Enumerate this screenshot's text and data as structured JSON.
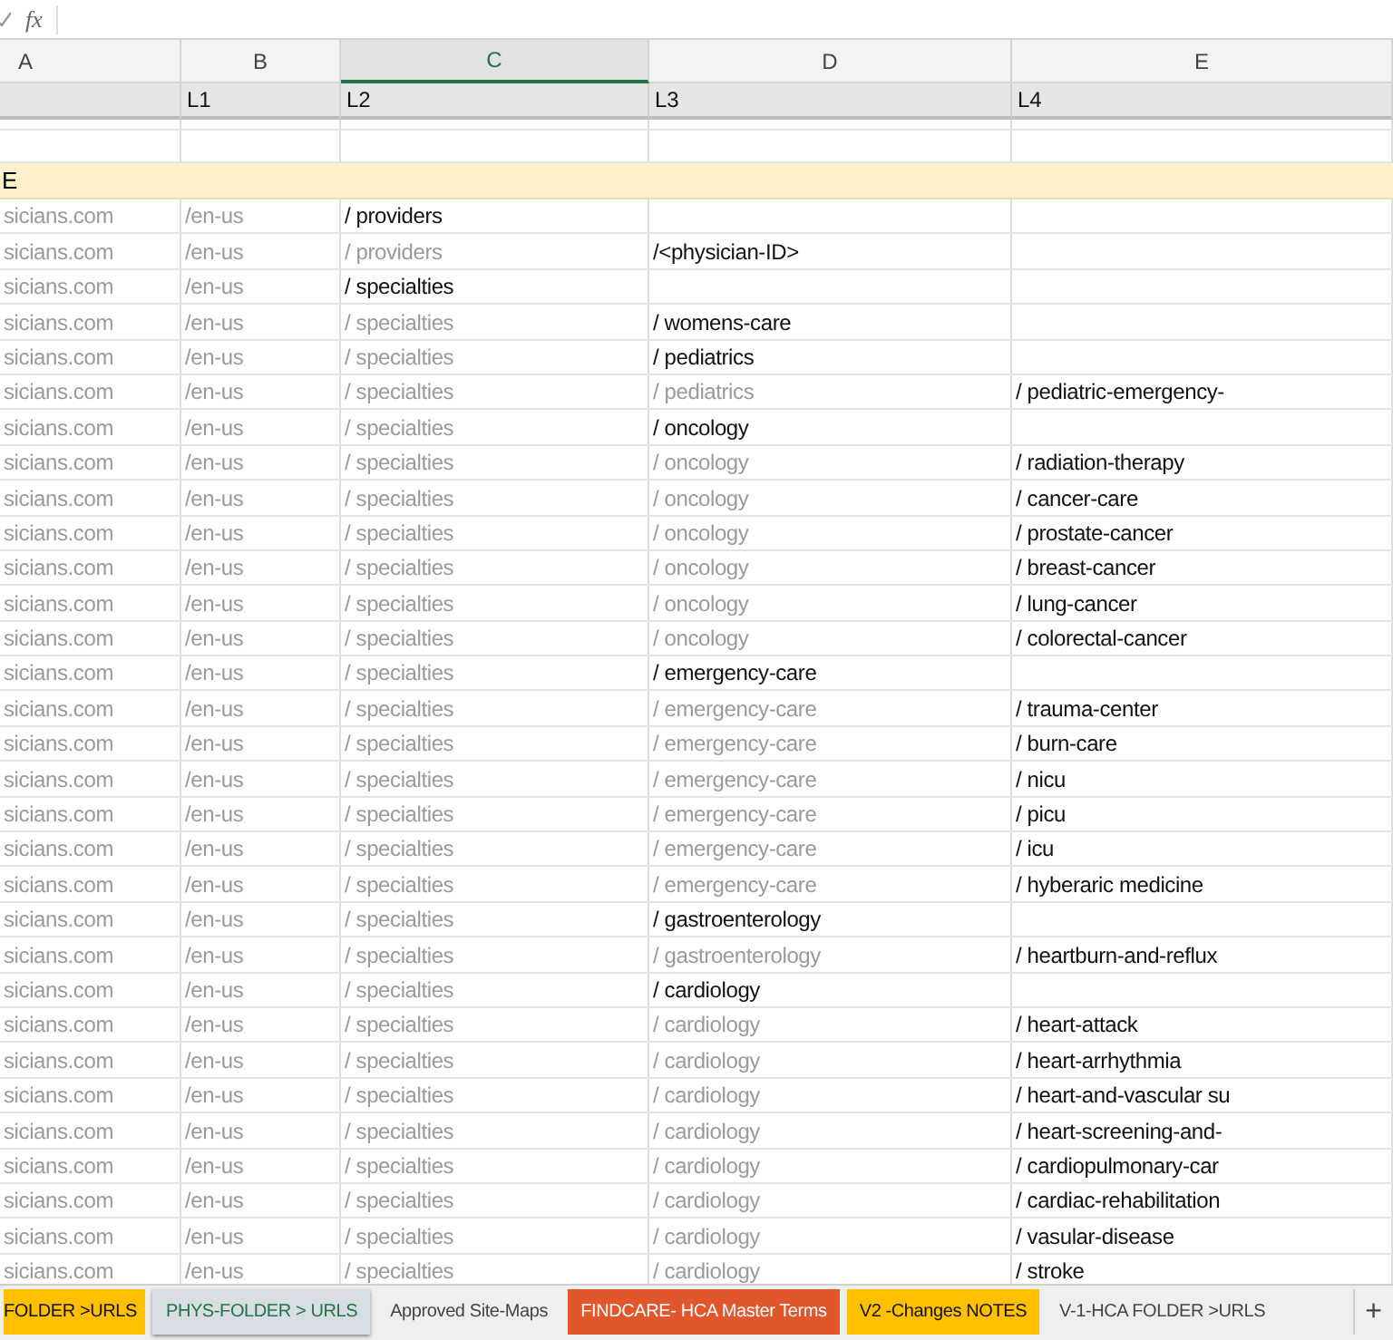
{
  "formula_bar": {
    "function_label": "fx"
  },
  "column_headers": [
    {
      "label": "A",
      "selected": false
    },
    {
      "label": "B",
      "selected": false
    },
    {
      "label": "C",
      "selected": true
    },
    {
      "label": "D",
      "selected": false
    },
    {
      "label": "E",
      "selected": false
    }
  ],
  "level_header": {
    "b": "L1",
    "c": "L2",
    "d": "L3",
    "e": "L4"
  },
  "section_row": {
    "label": "E"
  },
  "rows": [
    {
      "a": {
        "text": "sicians.com",
        "dim": true
      },
      "b": {
        "text": "/en-us",
        "dim": true
      },
      "c": {
        "text": "/ providers",
        "dim": false
      }
    },
    {
      "a": {
        "text": "sicians.com",
        "dim": true
      },
      "b": {
        "text": "/en-us",
        "dim": true
      },
      "c": {
        "text": "/ providers",
        "dim": true
      },
      "d": {
        "text": "/<physician-ID>",
        "dim": false
      }
    },
    {
      "a": {
        "text": "sicians.com",
        "dim": true
      },
      "b": {
        "text": "/en-us",
        "dim": true
      },
      "c": {
        "text": "/ specialties",
        "dim": false
      }
    },
    {
      "a": {
        "text": "sicians.com",
        "dim": true
      },
      "b": {
        "text": "/en-us",
        "dim": true
      },
      "c": {
        "text": "/ specialties",
        "dim": true
      },
      "d": {
        "text": "/ womens-care",
        "dim": false
      }
    },
    {
      "a": {
        "text": "sicians.com",
        "dim": true
      },
      "b": {
        "text": "/en-us",
        "dim": true
      },
      "c": {
        "text": "/ specialties",
        "dim": true
      },
      "d": {
        "text": "/ pediatrics",
        "dim": false
      }
    },
    {
      "a": {
        "text": "sicians.com",
        "dim": true
      },
      "b": {
        "text": "/en-us",
        "dim": true
      },
      "c": {
        "text": "/ specialties",
        "dim": true
      },
      "d": {
        "text": "/ pediatrics",
        "dim": true
      },
      "e": {
        "text": "/ pediatric-emergency-",
        "dim": false
      }
    },
    {
      "a": {
        "text": "sicians.com",
        "dim": true
      },
      "b": {
        "text": "/en-us",
        "dim": true
      },
      "c": {
        "text": "/ specialties",
        "dim": true
      },
      "d": {
        "text": "/ oncology",
        "dim": false
      }
    },
    {
      "a": {
        "text": "sicians.com",
        "dim": true
      },
      "b": {
        "text": "/en-us",
        "dim": true
      },
      "c": {
        "text": "/ specialties",
        "dim": true
      },
      "d": {
        "text": "/ oncology",
        "dim": true
      },
      "e": {
        "text": "/ radiation-therapy",
        "dim": false
      }
    },
    {
      "a": {
        "text": "sicians.com",
        "dim": true
      },
      "b": {
        "text": "/en-us",
        "dim": true
      },
      "c": {
        "text": "/ specialties",
        "dim": true
      },
      "d": {
        "text": "/ oncology",
        "dim": true
      },
      "e": {
        "text": "/ cancer-care",
        "dim": false
      }
    },
    {
      "a": {
        "text": "sicians.com",
        "dim": true
      },
      "b": {
        "text": "/en-us",
        "dim": true
      },
      "c": {
        "text": "/ specialties",
        "dim": true
      },
      "d": {
        "text": "/ oncology",
        "dim": true
      },
      "e": {
        "text": "/ prostate-cancer",
        "dim": false
      }
    },
    {
      "a": {
        "text": "sicians.com",
        "dim": true
      },
      "b": {
        "text": "/en-us",
        "dim": true
      },
      "c": {
        "text": "/ specialties",
        "dim": true
      },
      "d": {
        "text": "/ oncology",
        "dim": true
      },
      "e": {
        "text": "/ breast-cancer",
        "dim": false
      }
    },
    {
      "a": {
        "text": "sicians.com",
        "dim": true
      },
      "b": {
        "text": "/en-us",
        "dim": true
      },
      "c": {
        "text": "/ specialties",
        "dim": true
      },
      "d": {
        "text": "/ oncology",
        "dim": true
      },
      "e": {
        "text": "/ lung-cancer",
        "dim": false
      }
    },
    {
      "a": {
        "text": "sicians.com",
        "dim": true
      },
      "b": {
        "text": "/en-us",
        "dim": true
      },
      "c": {
        "text": "/ specialties",
        "dim": true
      },
      "d": {
        "text": "/ oncology",
        "dim": true
      },
      "e": {
        "text": "/ colorectal-cancer",
        "dim": false
      }
    },
    {
      "a": {
        "text": "sicians.com",
        "dim": true
      },
      "b": {
        "text": "/en-us",
        "dim": true
      },
      "c": {
        "text": "/ specialties",
        "dim": true
      },
      "d": {
        "text": "/ emergency-care",
        "dim": false
      }
    },
    {
      "a": {
        "text": "sicians.com",
        "dim": true
      },
      "b": {
        "text": "/en-us",
        "dim": true
      },
      "c": {
        "text": "/ specialties",
        "dim": true
      },
      "d": {
        "text": "/ emergency-care",
        "dim": true
      },
      "e": {
        "text": "/ trauma-center",
        "dim": false
      }
    },
    {
      "a": {
        "text": "sicians.com",
        "dim": true
      },
      "b": {
        "text": "/en-us",
        "dim": true
      },
      "c": {
        "text": "/ specialties",
        "dim": true
      },
      "d": {
        "text": "/ emergency-care",
        "dim": true
      },
      "e": {
        "text": "/ burn-care",
        "dim": false
      }
    },
    {
      "a": {
        "text": "sicians.com",
        "dim": true
      },
      "b": {
        "text": "/en-us",
        "dim": true
      },
      "c": {
        "text": "/ specialties",
        "dim": true
      },
      "d": {
        "text": "/ emergency-care",
        "dim": true
      },
      "e": {
        "text": "/ nicu",
        "dim": false
      }
    },
    {
      "a": {
        "text": "sicians.com",
        "dim": true
      },
      "b": {
        "text": "/en-us",
        "dim": true
      },
      "c": {
        "text": "/ specialties",
        "dim": true
      },
      "d": {
        "text": "/ emergency-care",
        "dim": true
      },
      "e": {
        "text": "/ picu",
        "dim": false
      }
    },
    {
      "a": {
        "text": "sicians.com",
        "dim": true
      },
      "b": {
        "text": "/en-us",
        "dim": true
      },
      "c": {
        "text": "/ specialties",
        "dim": true
      },
      "d": {
        "text": "/ emergency-care",
        "dim": true
      },
      "e": {
        "text": "/ icu",
        "dim": false
      }
    },
    {
      "a": {
        "text": "sicians.com",
        "dim": true
      },
      "b": {
        "text": "/en-us",
        "dim": true
      },
      "c": {
        "text": "/ specialties",
        "dim": true
      },
      "d": {
        "text": "/ emergency-care",
        "dim": true
      },
      "e": {
        "text": "/ hyberaric medicine",
        "dim": false
      }
    },
    {
      "a": {
        "text": "sicians.com",
        "dim": true
      },
      "b": {
        "text": "/en-us",
        "dim": true
      },
      "c": {
        "text": "/ specialties",
        "dim": true
      },
      "d": {
        "text": "/ gastroenterology",
        "dim": false
      }
    },
    {
      "a": {
        "text": "sicians.com",
        "dim": true
      },
      "b": {
        "text": "/en-us",
        "dim": true
      },
      "c": {
        "text": "/ specialties",
        "dim": true
      },
      "d": {
        "text": "/ gastroenterology",
        "dim": true
      },
      "e": {
        "text": "/ heartburn-and-reflux",
        "dim": false
      }
    },
    {
      "a": {
        "text": "sicians.com",
        "dim": true
      },
      "b": {
        "text": "/en-us",
        "dim": true
      },
      "c": {
        "text": "/ specialties",
        "dim": true
      },
      "d": {
        "text": "/ cardiology",
        "dim": false
      }
    },
    {
      "a": {
        "text": "sicians.com",
        "dim": true
      },
      "b": {
        "text": "/en-us",
        "dim": true
      },
      "c": {
        "text": "/ specialties",
        "dim": true
      },
      "d": {
        "text": "/ cardiology",
        "dim": true
      },
      "e": {
        "text": "/ heart-attack",
        "dim": false
      }
    },
    {
      "a": {
        "text": "sicians.com",
        "dim": true
      },
      "b": {
        "text": "/en-us",
        "dim": true
      },
      "c": {
        "text": "/ specialties",
        "dim": true
      },
      "d": {
        "text": "/ cardiology",
        "dim": true
      },
      "e": {
        "text": "/ heart-arrhythmia",
        "dim": false
      }
    },
    {
      "a": {
        "text": "sicians.com",
        "dim": true
      },
      "b": {
        "text": "/en-us",
        "dim": true
      },
      "c": {
        "text": "/ specialties",
        "dim": true
      },
      "d": {
        "text": "/ cardiology",
        "dim": true
      },
      "e": {
        "text": "/ heart-and-vascular su",
        "dim": false
      }
    },
    {
      "a": {
        "text": "sicians.com",
        "dim": true
      },
      "b": {
        "text": "/en-us",
        "dim": true
      },
      "c": {
        "text": "/ specialties",
        "dim": true
      },
      "d": {
        "text": "/ cardiology",
        "dim": true
      },
      "e": {
        "text": "/ heart-screening-and-",
        "dim": false
      }
    },
    {
      "a": {
        "text": "sicians.com",
        "dim": true
      },
      "b": {
        "text": "/en-us",
        "dim": true
      },
      "c": {
        "text": "/ specialties",
        "dim": true
      },
      "d": {
        "text": "/ cardiology",
        "dim": true
      },
      "e": {
        "text": "/ cardiopulmonary-car",
        "dim": false
      }
    },
    {
      "a": {
        "text": "sicians.com",
        "dim": true
      },
      "b": {
        "text": "/en-us",
        "dim": true
      },
      "c": {
        "text": "/ specialties",
        "dim": true
      },
      "d": {
        "text": "/ cardiology",
        "dim": true
      },
      "e": {
        "text": "/ cardiac-rehabilitation",
        "dim": false
      }
    },
    {
      "a": {
        "text": "sicians.com",
        "dim": true
      },
      "b": {
        "text": "/en-us",
        "dim": true
      },
      "c": {
        "text": "/ specialties",
        "dim": true
      },
      "d": {
        "text": "/ cardiology",
        "dim": true
      },
      "e": {
        "text": "/ vasular-disease",
        "dim": false
      }
    },
    {
      "a": {
        "text": "sicians.com",
        "dim": true
      },
      "b": {
        "text": "/en-us",
        "dim": true
      },
      "c": {
        "text": "/ specialties",
        "dim": true
      },
      "d": {
        "text": "/ cardiology",
        "dim": true
      },
      "e": {
        "text": "/ stroke",
        "dim": false
      }
    }
  ],
  "sheet_tabs": [
    {
      "label": "FOLDER >URLS",
      "selected": false,
      "color": "#ffc000"
    },
    {
      "label": "PHYS-FOLDER > URLS",
      "selected": true
    },
    {
      "label": "Approved Site-Maps",
      "selected": false
    },
    {
      "label": "FINDCARE- HCA Master Terms",
      "selected": false,
      "color": "#e2562c"
    },
    {
      "label": "V2 -Changes NOTES",
      "selected": false,
      "color": "#ffc000"
    },
    {
      "label": "V-1-HCA FOLDER >URLS",
      "selected": false
    }
  ],
  "add_sheet_button": {
    "label": "+"
  }
}
